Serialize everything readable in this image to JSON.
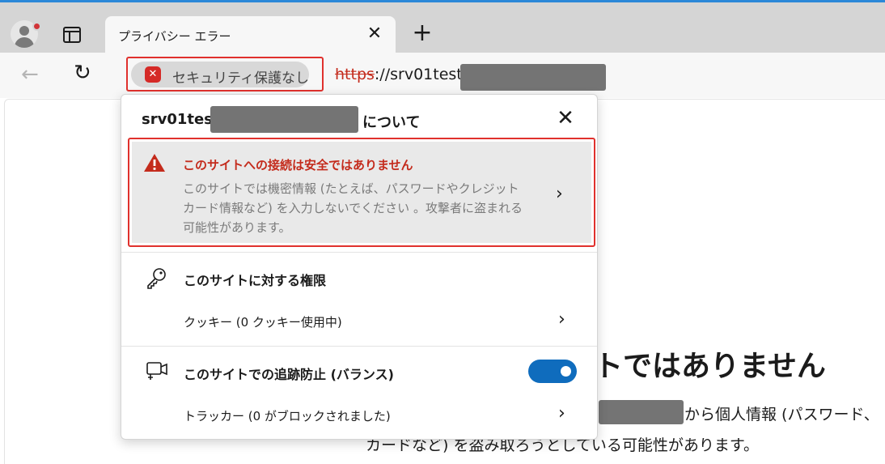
{
  "browser": {
    "tab": {
      "title": "プライバシー エラー",
      "close_glyph": "✕"
    },
    "new_tab_glyph": "+",
    "back_glyph": "←",
    "refresh_glyph": "↻",
    "security_chip": {
      "label": "セキュリティ保護なし",
      "status_color": "#d52a27"
    },
    "address": {
      "scheme": "https",
      "rest": "://srv01test."
    },
    "accent_color": "#0f6cbd"
  },
  "popup": {
    "host_prefix": "srv01test.",
    "about_suffix": "について",
    "close_glyph": "✕",
    "warning": {
      "title": "このサイトへの接続は安全ではありません",
      "description": "このサイトでは機密情報 (たとえば、パスワードやクレジット カード情報など) を入力しないでください 。攻撃者に盗まれる可能性があります。",
      "chevron": "›",
      "title_color": "#c42b1c"
    },
    "permissions": {
      "title": "このサイトに対する権限",
      "cookies_label": "クッキー (0 クッキー使用中)",
      "chevron": "›"
    },
    "tracking": {
      "title": "このサイトでの追跡防止 (バランス)",
      "toggle_on": true,
      "trackers_label": "トラッカー (0 がブロックされました)",
      "chevron": "›"
    }
  },
  "page": {
    "heading_visible": "トではありません",
    "line1_suffix": "から個人情報 (パスワード、",
    "line2": "カードなど) を盗み取ろうとしている可能性があります。"
  }
}
